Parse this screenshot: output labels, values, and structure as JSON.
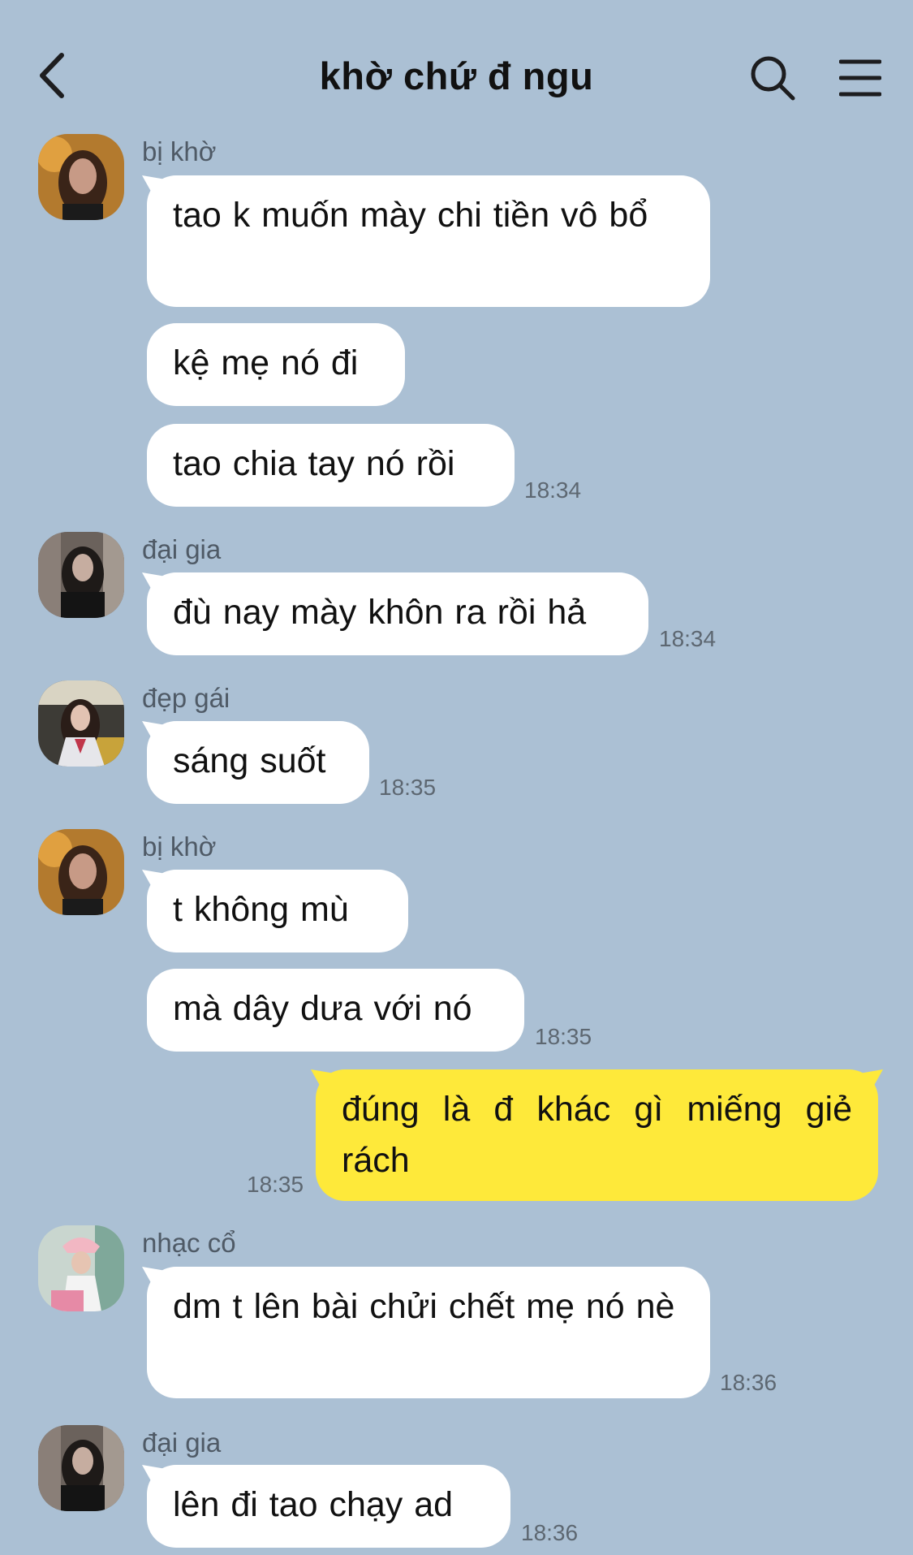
{
  "header": {
    "title": "khờ chứ đ ngu",
    "icons": [
      "back-chevron-icon",
      "search-icon",
      "menu-icon"
    ]
  },
  "colors": {
    "background": "#abc0d4",
    "incoming_bubble": "#ffffff",
    "outgoing_bubble": "#fee93a"
  },
  "messages": [
    {
      "sender": "bị khờ",
      "texts": [
        "tao k muốn mày chi tiền vô bổ",
        "kệ mẹ nó đi",
        "tao chia tay nó rồi"
      ],
      "time": "18:34"
    },
    {
      "sender": "đại gia",
      "texts": [
        "đù nay mày khôn ra rồi hả"
      ],
      "time": "18:34"
    },
    {
      "sender": "đẹp gái",
      "texts": [
        "sáng suốt"
      ],
      "time": "18:35"
    },
    {
      "sender": "bị khờ",
      "texts": [
        "t không mù",
        "mà dây dưa với nó"
      ],
      "time": "18:35"
    },
    {
      "sender": "me",
      "texts": [
        "đúng là đ khác gì miếng giẻ rách"
      ],
      "time": "18:35"
    },
    {
      "sender": "nhạc cổ",
      "texts": [
        "dm t lên bài chửi chết mẹ nó nè"
      ],
      "time": "18:36"
    },
    {
      "sender": "đại gia",
      "texts": [
        "lên đi tao chạy ad"
      ],
      "time": "18:36"
    }
  ]
}
